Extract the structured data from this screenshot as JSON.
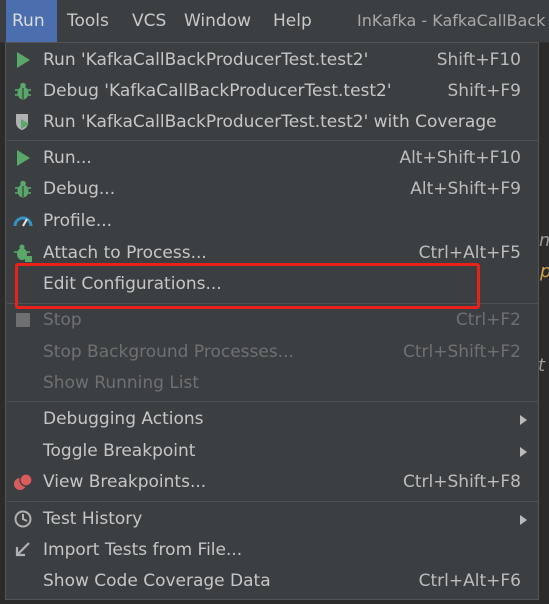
{
  "menubar": {
    "items": [
      "Run",
      "Tools",
      "VCS",
      "Window",
      "Help"
    ],
    "window_title": "InKafka - KafkaCallBack"
  },
  "menu": {
    "items": [
      {
        "label": "Run 'KafkaCallBackProducerTest.test2'",
        "shortcut": "Shift+F10",
        "icon": "run-icon"
      },
      {
        "label": "Debug 'KafkaCallBackProducerTest.test2'",
        "shortcut": "Shift+F9",
        "icon": "debug-icon"
      },
      {
        "label": "Run 'KafkaCallBackProducerTest.test2' with Coverage",
        "shortcut": "",
        "icon": "coverage-icon"
      },
      {
        "label": "Run...",
        "shortcut": "Alt+Shift+F10",
        "icon": "run-icon"
      },
      {
        "label": "Debug...",
        "shortcut": "Alt+Shift+F9",
        "icon": "debug-icon"
      },
      {
        "label": "Profile...",
        "shortcut": "",
        "icon": "profile-icon"
      },
      {
        "label": "Attach to Process...",
        "shortcut": "Ctrl+Alt+F5",
        "icon": "attach-icon"
      },
      {
        "label": "Edit Configurations...",
        "shortcut": "",
        "icon": ""
      },
      {
        "label": "Stop",
        "shortcut": "Ctrl+F2",
        "icon": "stop-icon"
      },
      {
        "label": "Stop Background Processes...",
        "shortcut": "Ctrl+Shift+F2",
        "icon": ""
      },
      {
        "label": "Show Running List",
        "shortcut": "",
        "icon": ""
      },
      {
        "label": "Debugging Actions",
        "shortcut": "",
        "icon": "",
        "submenu": true
      },
      {
        "label": "Toggle Breakpoint",
        "shortcut": "",
        "icon": "",
        "submenu": true
      },
      {
        "label": "View Breakpoints...",
        "shortcut": "Ctrl+Shift+F8",
        "icon": "breakpoints-icon"
      },
      {
        "label": "Test History",
        "shortcut": "",
        "icon": "history-icon",
        "submenu": true
      },
      {
        "label": "Import Tests from File...",
        "shortcut": "",
        "icon": "import-icon"
      },
      {
        "label": "Show Code Coverage Data",
        "shortcut": "Ctrl+Alt+F6",
        "icon": ""
      }
    ]
  },
  "colors": {
    "accent": "#4b6eaf",
    "run_green": "#59a869",
    "highlight_red": "#e8211a",
    "breakpoint_red": "#db5c5c",
    "profile_blue": "#3592c4"
  }
}
